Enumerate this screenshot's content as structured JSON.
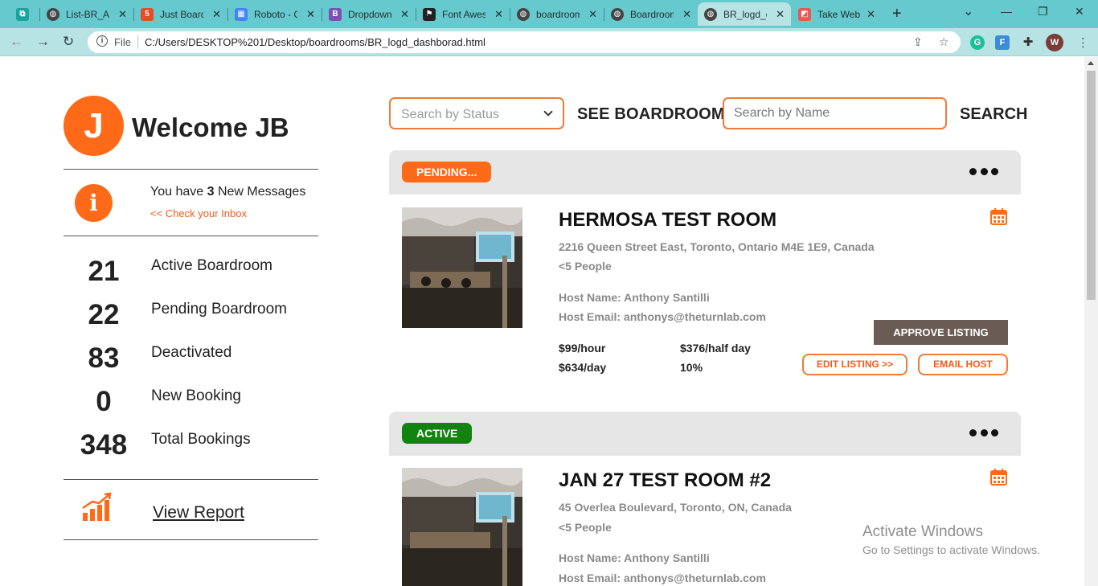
{
  "browser": {
    "tabs": [
      {
        "label": "",
        "icon": "app-icon",
        "color": "#1aa39a"
      },
      {
        "label": "List-BR_Ad",
        "icon": "globe-icon",
        "color": "#555"
      },
      {
        "label": "Just Board",
        "icon": "html5-icon",
        "color": "#e44d26"
      },
      {
        "label": "Roboto - G",
        "icon": "google-fonts-icon",
        "color": "#4285f4"
      },
      {
        "label": "Dropdown",
        "icon": "bootstrap-icon",
        "color": "#7952b3"
      },
      {
        "label": "Font Awes",
        "icon": "flag-icon",
        "color": "#222"
      },
      {
        "label": "boardroom",
        "icon": "globe-icon",
        "color": "#555"
      },
      {
        "label": "Boardroom",
        "icon": "globe-icon",
        "color": "#555"
      },
      {
        "label": "BR_logd_d",
        "icon": "globe-icon",
        "color": "#555"
      },
      {
        "label": "Take Web",
        "icon": "screenshot-icon",
        "color": "#e55"
      }
    ],
    "file_label": "File",
    "url": "C:/Users/DESKTOP%201/Desktop/boardrooms/BR_logd_dashborad.html",
    "profile_initial": "W"
  },
  "sidebar": {
    "avatar_initial": "J",
    "welcome": "Welcome JB",
    "messages": {
      "prefix": "You have ",
      "count": "3",
      "suffix": " New Messages",
      "link": "<< Check your Inbox"
    },
    "stats": [
      {
        "value": "21",
        "label": "Active Boardroom"
      },
      {
        "value": "22",
        "label": "Pending Boardroom"
      },
      {
        "value": "83",
        "label": "Deactivated"
      },
      {
        "value": "0",
        "label": "New Booking"
      },
      {
        "value": "348",
        "label": "Total Bookings"
      }
    ],
    "view_report": "View Report"
  },
  "search": {
    "status_placeholder": "Search by Status",
    "see_boardroom": "SEE BOARDROOM",
    "name_placeholder": "Search by Name",
    "search_label": "SEARCH"
  },
  "listings": [
    {
      "status": "PENDING...",
      "status_color": "#fe6a17",
      "title": "HERMOSA TEST ROOM",
      "address": "2216 Queen Street East, Toronto, Ontario M4E 1E9, Canada",
      "capacity": "<5 People",
      "host_name": "Host Name: Anthony Santilli",
      "host_email": "Host Email: anthonys@theturnlab.com",
      "prices": [
        "$99/hour",
        "$376/half day",
        "$634/day",
        "10%"
      ],
      "approve": "APPROVE LISTING",
      "edit": "EDIT LISTING >>",
      "email": "EMAIL HOST"
    },
    {
      "status": "ACTIVE",
      "status_color": "#13830f",
      "title": "JAN 27 TEST ROOM #2",
      "address": "45 Overlea Boulevard, Toronto, ON, Canada",
      "capacity": "<5 People",
      "host_name": "Host Name: Anthony Santilli",
      "host_email": "Host Email: anthonys@theturnlab.com"
    }
  ],
  "watermark": {
    "line1": "Activate Windows",
    "line2": "Go to Settings to activate Windows."
  }
}
